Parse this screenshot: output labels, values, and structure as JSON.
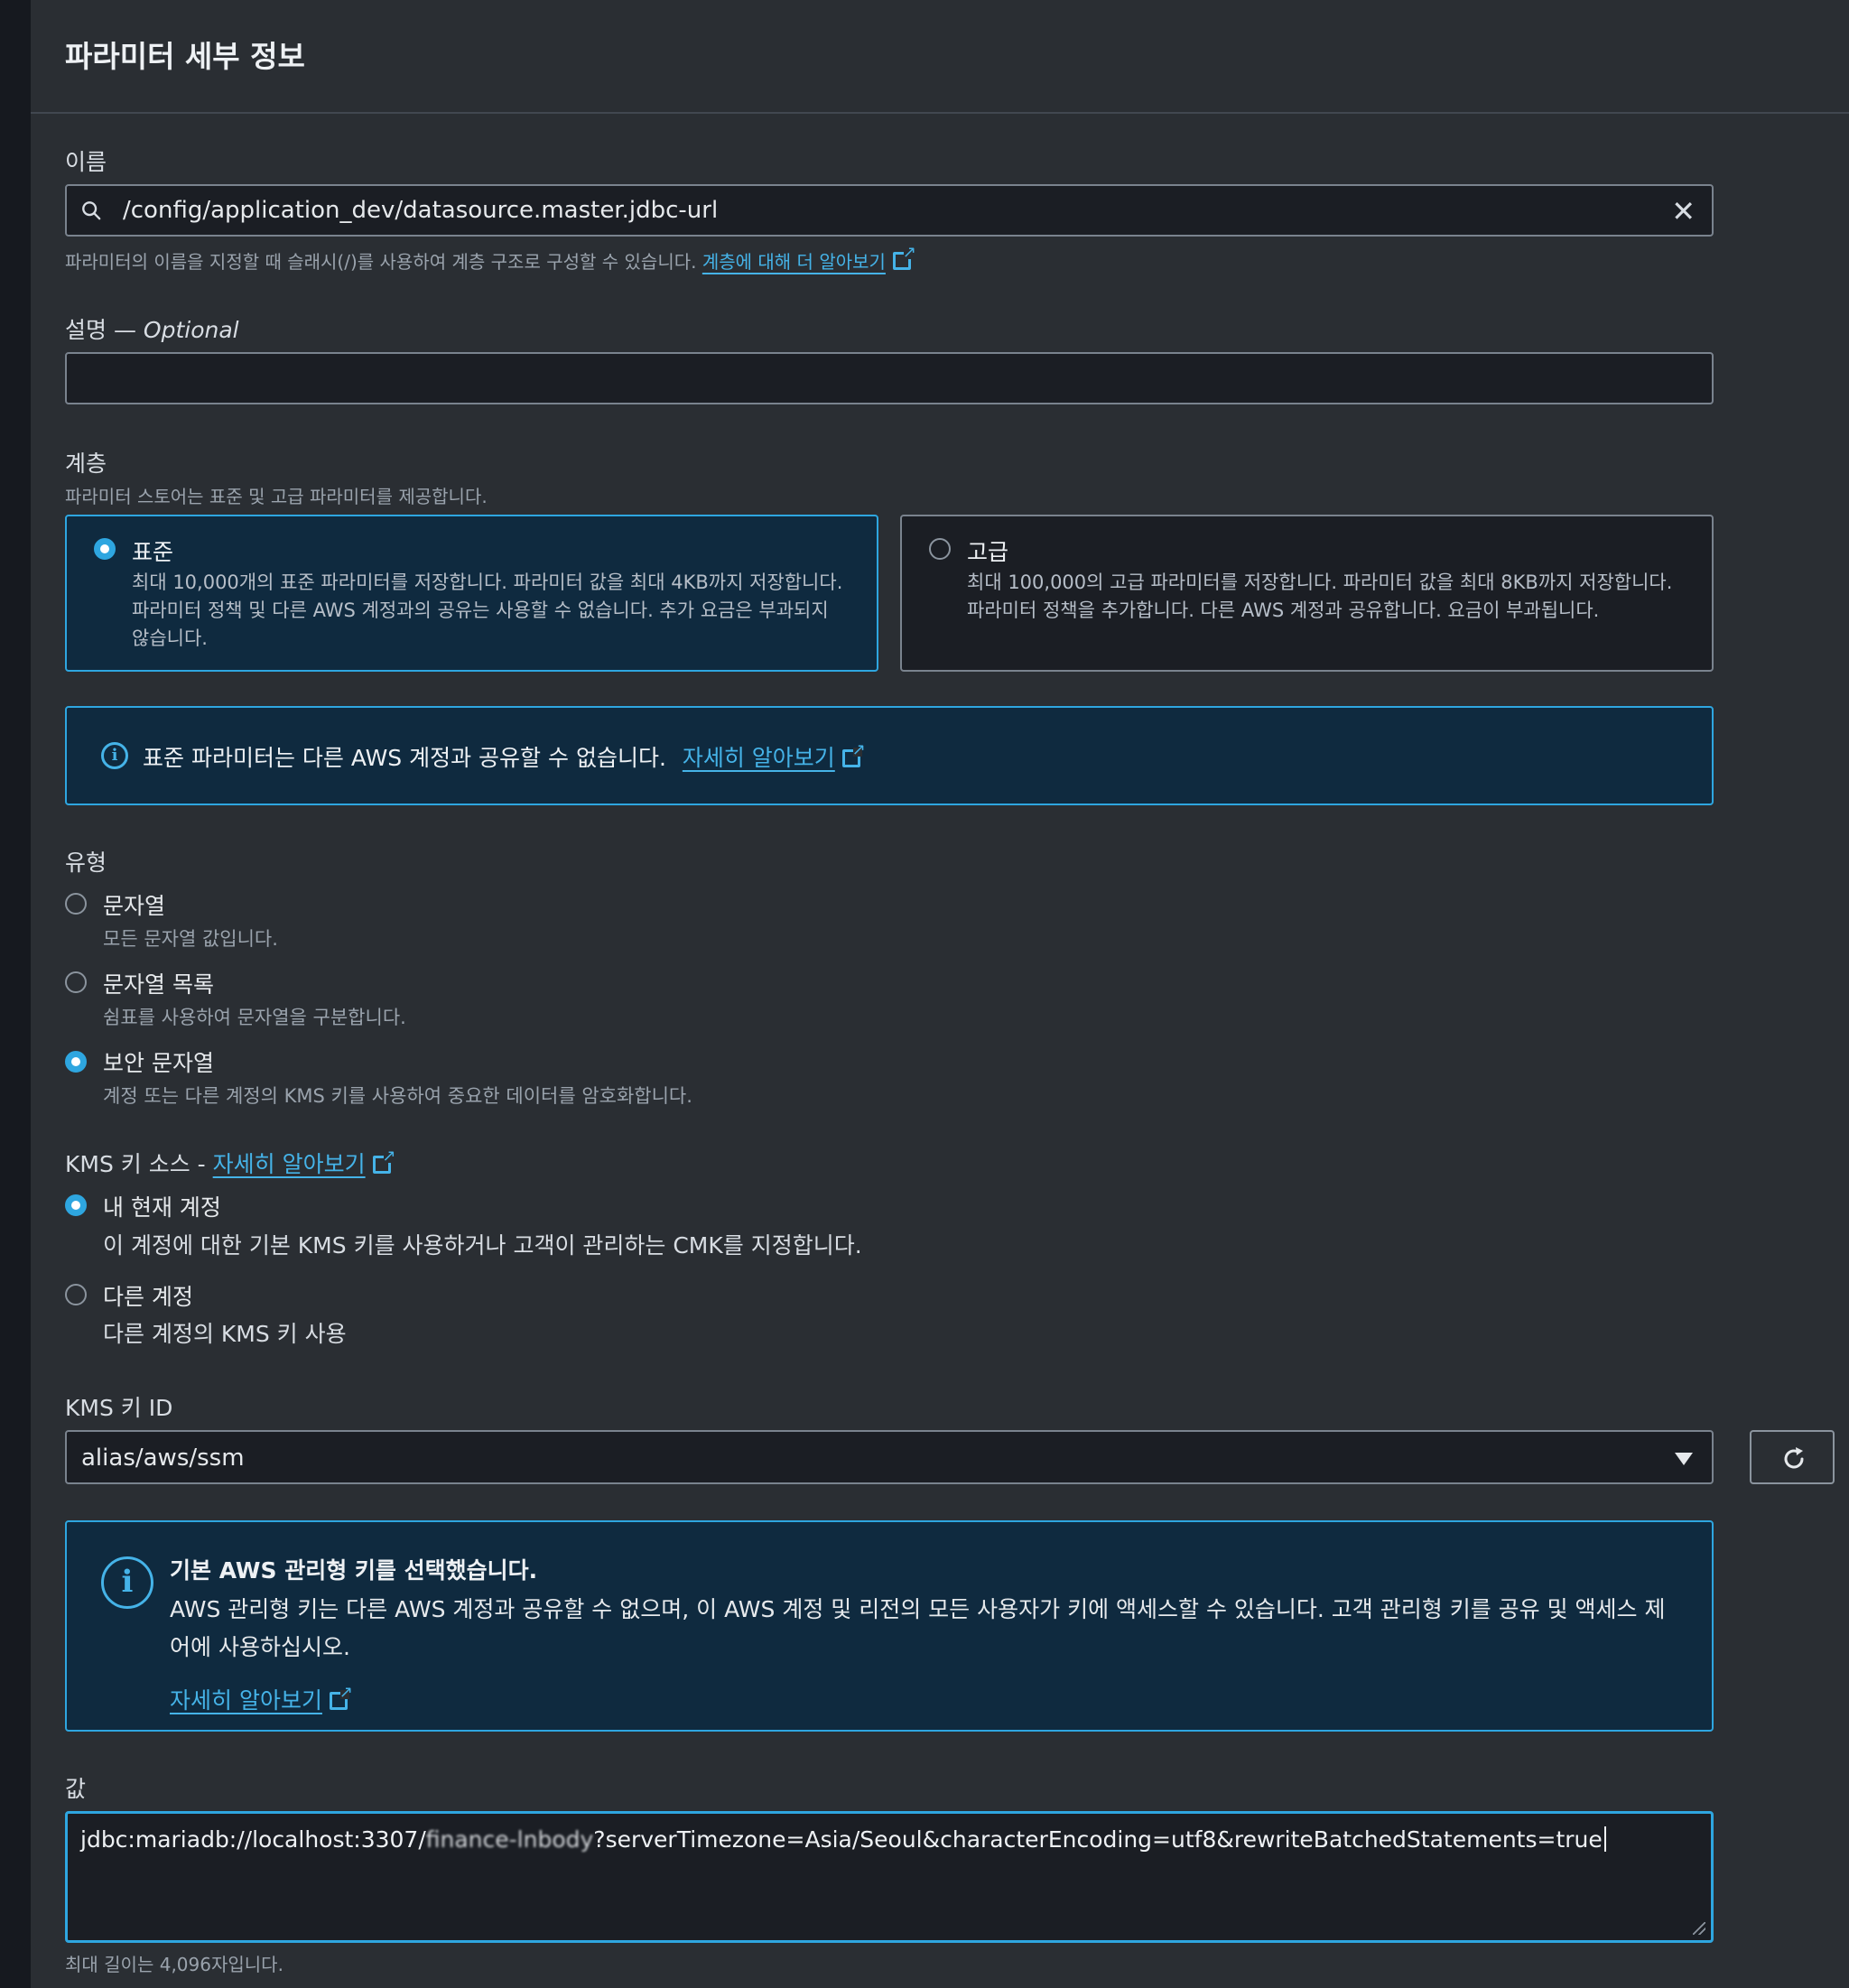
{
  "header": {
    "title": "파라미터 세부 정보"
  },
  "name": {
    "label": "이름",
    "value": "/config/application_dev/datasource.master.jdbc-url",
    "hint": "파라미터의 이름을 지정할 때 슬래시(/)를 사용하여 계층 구조로 구성할 수 있습니다.",
    "hint_link": "계층에 대해 더 알아보기"
  },
  "description": {
    "label": "설명 — ",
    "label_optional": "Optional",
    "value": ""
  },
  "tier": {
    "label": "계층",
    "hint": "파라미터 스토어는 표준 및 고급 파라미터를 제공합니다.",
    "options": [
      {
        "title": "표준",
        "desc_line1": "최대 10,000개의 표준 파라미터를 저장합니다. 파라미터 값을 최대 4KB까지 저장합니다.",
        "desc_line2": "파라미터 정책 및 다른 AWS 계정과의 공유는 사용할 수 없습니다. 추가 요금은 부과되지",
        "desc_line3": "않습니다.",
        "selected": true
      },
      {
        "title": "고급",
        "desc_line1": "최대 100,000의 고급 파라미터를 저장합니다. 파라미터 값을 최대 8KB까지 저장합니다.",
        "desc_line2": "파라미터 정책을 추가합니다. 다른 AWS 계정과 공유합니다. 요금이 부과됩니다.",
        "selected": false
      }
    ],
    "alert_text": "표준 파라미터는 다른 AWS 계정과 공유할 수 없습니다.",
    "alert_link": "자세히 알아보기"
  },
  "type": {
    "label": "유형",
    "options": [
      {
        "title": "문자열",
        "desc": "모든 문자열 값입니다.",
        "selected": false
      },
      {
        "title": "문자열 목록",
        "desc": "쉼표를 사용하여 문자열을 구분합니다.",
        "selected": false
      },
      {
        "title": "보안 문자열",
        "desc": "계정 또는 다른 계정의 KMS 키를 사용하여 중요한 데이터를 암호화합니다.",
        "selected": true
      }
    ]
  },
  "kms_source": {
    "label": "KMS 키 소스 - ",
    "label_link": "자세히 알아보기",
    "options": [
      {
        "title": "내 현재 계정",
        "desc": "이 계정에 대한 기본 KMS 키를 사용하거나 고객이 관리하는 CMK를 지정합니다.",
        "selected": true
      },
      {
        "title": "다른 계정",
        "desc": "다른 계정의 KMS 키 사용",
        "selected": false
      }
    ]
  },
  "kms_key": {
    "label": "KMS 키 ID",
    "selected": "alias/aws/ssm",
    "alert_title": "기본 AWS 관리형 키를 선택했습니다.",
    "alert_line1": "AWS 관리형 키는 다른 AWS 계정과 공유할 수 없으며, 이 AWS 계정 및 리전의 모든 사용자가 키에 액세스할 수 있습니다. 고객 관리형 키를 공유 및 액세스 제",
    "alert_line2": "어에 사용하십시오.",
    "alert_link": "자세히 알아보기"
  },
  "value": {
    "label": "값",
    "text_prefix": "jdbc:mariadb://localhost:3307/",
    "text_redacted": "finance-lnbody",
    "text_suffix": "?serverTimezone=Asia/Seoul&characterEncoding=utf8&rewriteBatchedStatements=true",
    "hint": "최대 길이는 4,096자입니다."
  },
  "colors": {
    "accent": "#2ea6e0",
    "link": "#45b3e8",
    "panel": "#2a2e33",
    "alert_bg": "#0f2a3f"
  },
  "icons": [
    "search-icon",
    "close-icon",
    "external-link-icon",
    "info-icon",
    "dropdown-caret-icon",
    "refresh-icon"
  ]
}
